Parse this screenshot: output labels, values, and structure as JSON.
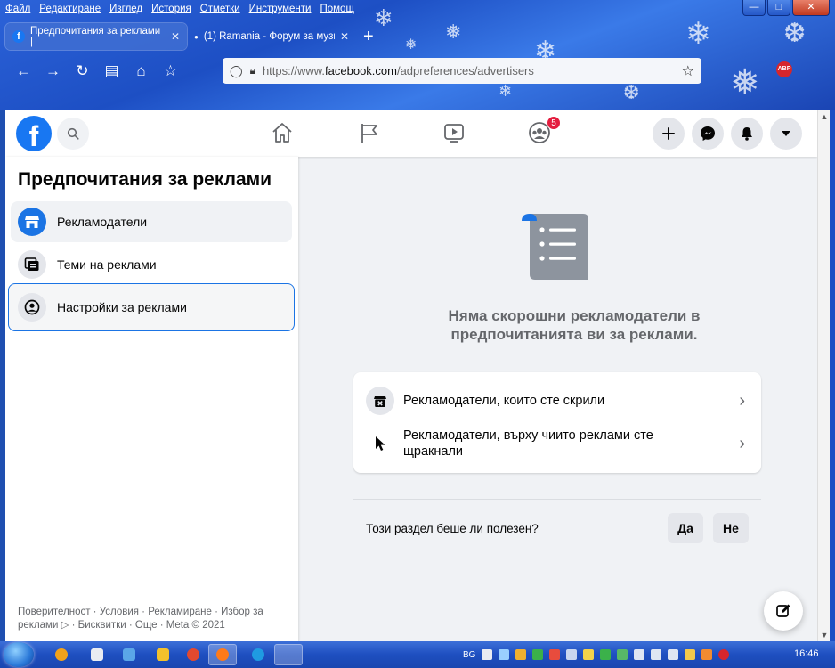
{
  "browser": {
    "menu": [
      "Файл",
      "Редактиране",
      "Изглед",
      "История",
      "Отметки",
      "Инструменти",
      "Помощ"
    ],
    "tabs": [
      {
        "title": "Предпочитания за реклами |",
        "active": true
      },
      {
        "title": "(1) Ramania - Форум за музика",
        "active": false
      }
    ],
    "url": {
      "protocol": "https://www.",
      "domain": "facebook.com",
      "path": "/adpreferences/advertisers"
    },
    "accent": "#1d4fc4"
  },
  "fb": {
    "logo": "f",
    "groups_badge": "5",
    "brand_color": "#1877f2"
  },
  "left_panel": {
    "title": "Предпочитания за реклами",
    "items": [
      {
        "label": "Рекламодатели",
        "icon": "store-icon",
        "state": "selected"
      },
      {
        "label": "Теми на реклами",
        "icon": "topics-icon",
        "state": "normal"
      },
      {
        "label": "Настройки за реклами",
        "icon": "account-icon",
        "state": "focused"
      }
    ],
    "footer_line1": "Поверителност · Условия · Рекламиране · Избор за",
    "footer_line2": "реклами ▷ · Бисквитки · Още · Meta © 2021"
  },
  "main": {
    "empty_message_line1": "Няма скорошни рекламодатели в",
    "empty_message_line2": "предпочитанията ви за реклами.",
    "card_rows": [
      {
        "label": "Рекламодатели, които сте скрили",
        "icon": "hidden-ad-icon"
      },
      {
        "label": "Рекламодатели, върху чиито реклами сте щракнали",
        "icon": "cursor-icon"
      }
    ],
    "feedback_question": "Този раздел беше ли полезен?",
    "yes_label": "Да",
    "no_label": "Не"
  },
  "taskbar": {
    "lang": "BG",
    "clock": "16:46"
  }
}
